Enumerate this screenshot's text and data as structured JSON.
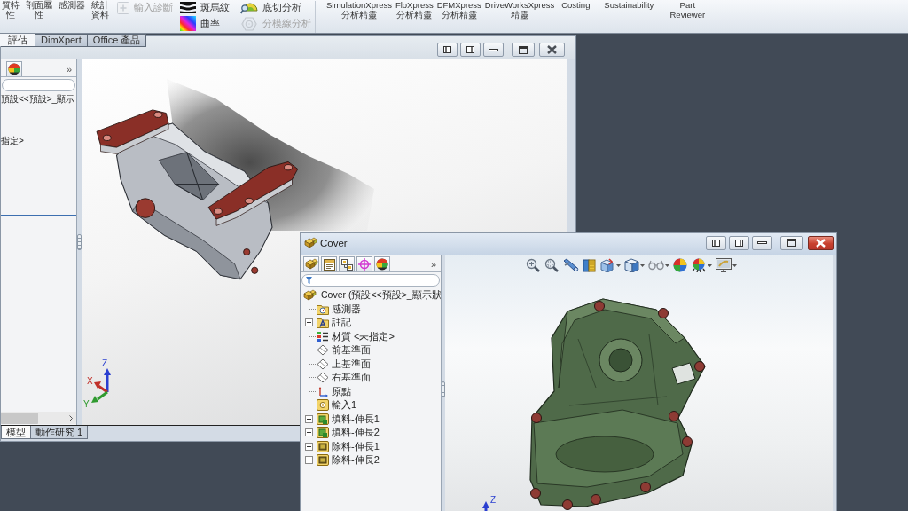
{
  "ribbon": {
    "left_buttons": [
      {
        "lines": [
          "質特",
          "性"
        ]
      },
      {
        "lines": [
          "剖面屬",
          "性"
        ]
      },
      {
        "lines": [
          "感測器"
        ]
      },
      {
        "lines": [
          "統計",
          "資料"
        ]
      }
    ],
    "tool_columns": [
      [
        {
          "kind": "import-diagnostics",
          "label": "輸入診斷",
          "disabled": true
        }
      ],
      [
        {
          "kind": "zebra",
          "label": "斑馬紋",
          "disabled": false
        },
        {
          "kind": "curvature",
          "label": "曲率",
          "disabled": false
        }
      ],
      [
        {
          "kind": "undercut",
          "label": "底切分析",
          "disabled": false
        },
        {
          "kind": "parting-line",
          "label": "分模線分析",
          "disabled": true
        }
      ]
    ],
    "right_buttons": [
      {
        "lines": [
          "SimulationXpress",
          "分析精靈"
        ]
      },
      {
        "lines": [
          "FloXpress",
          "分析精靈"
        ]
      },
      {
        "lines": [
          "DFMXpress",
          "分析精靈"
        ]
      },
      {
        "lines": [
          "DriveWorksXpress",
          "精靈"
        ]
      },
      {
        "lines": [
          "Costing"
        ]
      },
      {
        "lines": [
          "Sustainability"
        ]
      },
      {
        "lines": [
          "Part",
          "Reviewer"
        ]
      }
    ],
    "tabs": [
      {
        "label": "評估",
        "selected": true
      },
      {
        "label": "DimXpert",
        "selected": false
      },
      {
        "label": "Office 產品",
        "selected": false
      }
    ]
  },
  "left_window": {
    "active": false,
    "panel_tabs": [
      {
        "kind": "display-manager"
      }
    ],
    "panel_overflow": "»",
    "tree": [
      {
        "label": "預設<<預設>_顯示"
      },
      {
        "label": "指定>"
      }
    ],
    "bottom_tabs": [
      {
        "label": "模型",
        "selected": true
      },
      {
        "label": "動作研究 1",
        "selected": false
      }
    ],
    "triad_labels": [
      "Z",
      "X",
      "Y"
    ]
  },
  "cover_window": {
    "title": "Cover",
    "active": true,
    "panel_tabs": [
      {
        "kind": "feature-manager"
      },
      {
        "kind": "property-manager"
      },
      {
        "kind": "configuration-manager"
      },
      {
        "kind": "dimxpert"
      },
      {
        "kind": "display-manager"
      }
    ],
    "panel_overflow": "»",
    "tree": [
      {
        "kind": "part",
        "label": "Cover (預設<<預設>_顯示狀",
        "expandable": false
      },
      {
        "kind": "sensors",
        "label": "感測器",
        "expandable": false
      },
      {
        "kind": "annotations",
        "label": "註記",
        "expandable": true
      },
      {
        "kind": "material",
        "label": "材質 <未指定>",
        "expandable": false
      },
      {
        "kind": "plane",
        "label": "前基準面",
        "expandable": false
      },
      {
        "kind": "plane",
        "label": "上基準面",
        "expandable": false
      },
      {
        "kind": "plane",
        "label": "右基準面",
        "expandable": false
      },
      {
        "kind": "origin",
        "label": "原點",
        "expandable": false
      },
      {
        "kind": "imported",
        "label": "輸入1",
        "expandable": false
      },
      {
        "kind": "boss",
        "label": "填料-伸長1",
        "expandable": true
      },
      {
        "kind": "boss",
        "label": "填料-伸長2",
        "expandable": true
      },
      {
        "kind": "cut",
        "label": "除料-伸長1",
        "expandable": true
      },
      {
        "kind": "cut",
        "label": "除料-伸長2",
        "expandable": true
      }
    ],
    "view_tools": [
      {
        "kind": "zoom-fit",
        "dropdown": false
      },
      {
        "kind": "zoom-area",
        "dropdown": false
      },
      {
        "kind": "previous-view",
        "dropdown": false
      },
      {
        "kind": "section-view",
        "dropdown": false
      },
      {
        "kind": "view-orientation",
        "dropdown": true
      },
      {
        "kind": "display-style",
        "dropdown": true
      },
      {
        "kind": "hide-show",
        "dropdown": true
      },
      {
        "kind": "appearance",
        "dropdown": false
      },
      {
        "kind": "scene",
        "dropdown": true
      },
      {
        "kind": "view-settings",
        "dropdown": true
      }
    ],
    "triad_labels": [
      "Z"
    ]
  }
}
